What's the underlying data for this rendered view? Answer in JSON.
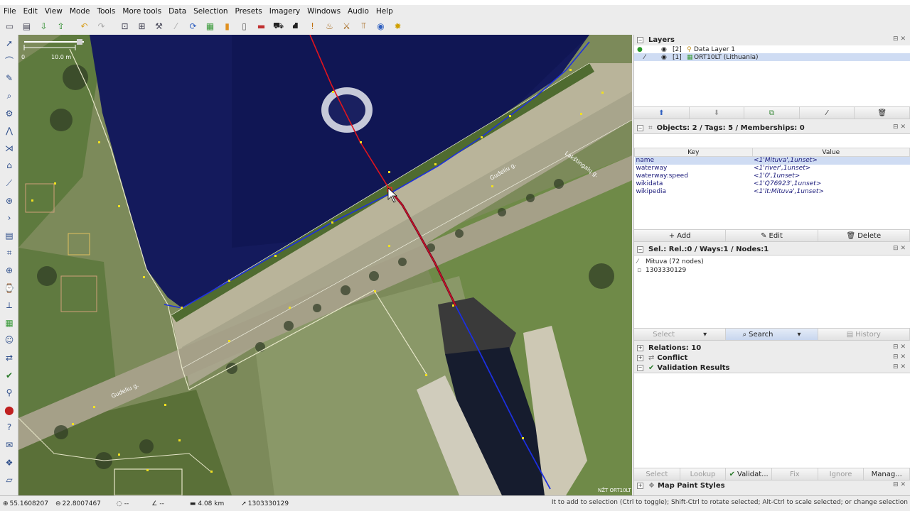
{
  "menu": [
    "File",
    "Edit",
    "View",
    "Mode",
    "Tools",
    "More tools",
    "Data",
    "Selection",
    "Presets",
    "Imagery",
    "Windows",
    "Audio",
    "Help"
  ],
  "map": {
    "scale_label": "10.0 m",
    "scale_zero": "0",
    "street_labels": [
      "Gudeliu g.",
      "Gudeliu g.",
      "Lakštingalų g."
    ],
    "attribution": "NŽT ORT10LT"
  },
  "layers": {
    "title": "Layers",
    "items": [
      {
        "index": "[2]",
        "name": "Data Layer 1"
      },
      {
        "index": "[1]",
        "name": "ORT10LT (Lithuania)"
      }
    ]
  },
  "tags": {
    "title": "Objects: 2 / Tags: 5 / Memberships: 0",
    "col_key": "Key",
    "col_value": "Value",
    "rows": [
      {
        "key": "name",
        "value": "<1'Mituva',1unset>"
      },
      {
        "key": "waterway",
        "value": "<1'river',1unset>"
      },
      {
        "key": "waterway:speed",
        "value": "<1'0',1unset>"
      },
      {
        "key": "wikidata",
        "value": "<1'Q76923',1unset>"
      },
      {
        "key": "wikipedia",
        "value": "<1'lt:Mituva',1unset>"
      }
    ],
    "add": "Add",
    "edit": "Edit",
    "delete": "Delete"
  },
  "selection": {
    "title": "Sel.: Rel.:0 / Ways:1 / Nodes:1",
    "items": [
      "Mituva (72 nodes)",
      "1303330129"
    ],
    "select": "Select",
    "search": "Search",
    "history": "History"
  },
  "relations": {
    "title": "Relations: 10"
  },
  "conflict": {
    "title": "Conflict"
  },
  "validation": {
    "title": "Validation Results",
    "buttons": [
      "Select",
      "Lookup",
      "Validat...",
      "Fix",
      "Ignore",
      "Manag..."
    ]
  },
  "map_paint": {
    "title": "Map Paint Styles"
  },
  "status": {
    "lat": "55.1608207",
    "lon": "22.8007467",
    "heading": "--",
    "angle": "--",
    "distance": "4.08 km",
    "node_id": "1303330129",
    "hint": "It to add to selection (Ctrl to toggle); Shift-Ctrl to rotate selected; Alt-Ctrl to scale selected; or change selection"
  }
}
